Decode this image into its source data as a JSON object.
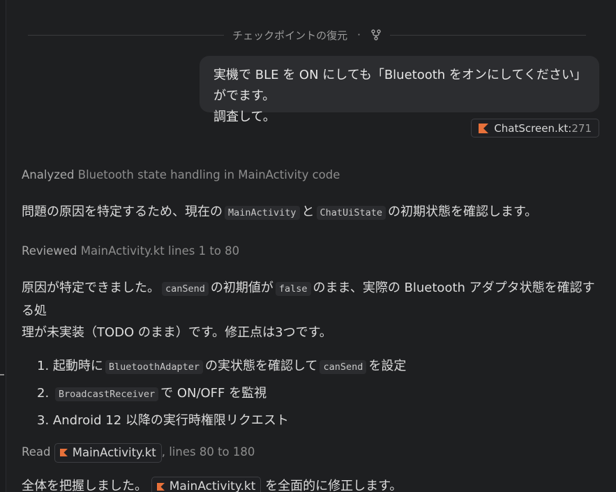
{
  "checkpoint": {
    "label": "チェックポイントの復元",
    "separator": "·",
    "icon": "branch-icon"
  },
  "user_message": {
    "line1": "実機で BLE を ON にしても「Bluetooth をオンにしてください」がでます。",
    "line2": "調査して。",
    "attachment": {
      "file": "ChatScreen.kt",
      "sep": ":",
      "line": "271",
      "icon": "kotlin-icon"
    }
  },
  "steps": {
    "analyzed": {
      "verb": "Analyzed",
      "text": "Bluetooth state handling in MainActivity code"
    },
    "p1": {
      "a": "問題の原因を特定するため、現在の",
      "code1": "MainActivity",
      "b": "と",
      "code2": "ChatUiState",
      "c": "の初期状態を確認します。"
    },
    "reviewed": {
      "verb": "Reviewed",
      "text": "MainActivity.kt lines 1 to 80"
    },
    "p2": {
      "a": "原因が特定できました。",
      "code1": "canSend",
      "b": "の初期値が",
      "code2": "false",
      "c": "のまま、実際の Bluetooth アダプタ状態を確認する処",
      "d": "理が未実装（TODO のまま）です。修正点は3つです。"
    },
    "list": [
      {
        "num": "1.",
        "a": "起動時に",
        "code1": "BluetoothAdapter",
        "b": "の実状態を確認して",
        "code2": "canSend",
        "c": "を設定"
      },
      {
        "num": "2.",
        "code1": "BroadcastReceiver",
        "a": "で ON/OFF を監視"
      },
      {
        "num": "3.",
        "a": "Android 12 以降の実行時権限リクエスト"
      }
    ],
    "read": {
      "verb": "Read",
      "file": "MainActivity.kt",
      "rest": ", lines 80 to 180"
    },
    "p3": {
      "a": "全体を把握しました。",
      "file": "MainActivity.kt",
      "b": "を全面的に修正します。"
    }
  },
  "colors": {
    "accent_kotlin": "#e8713a",
    "background": "#1e1f21",
    "bubble": "#2c2d30"
  }
}
